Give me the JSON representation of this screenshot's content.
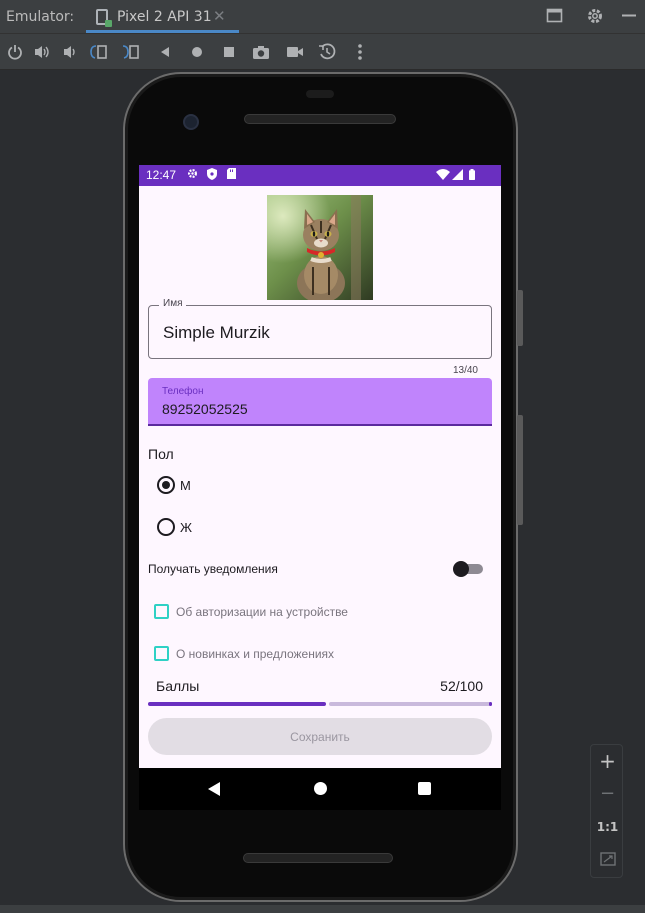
{
  "ide": {
    "title": "Emulator:",
    "tab_label": "Pixel 2 API 31",
    "tab_close": "✕"
  },
  "icons": {
    "maximize": "maximize-icon",
    "settings": "gear-icon",
    "minimize": "minimize-icon",
    "toolbar": [
      "power-icon",
      "volume-up-icon",
      "volume-down-icon",
      "rotate-left-icon",
      "rotate-right-icon",
      "back-icon",
      "home-icon",
      "overview-icon",
      "screenshot-icon",
      "record-icon",
      "snapshot-icon",
      "more-icon"
    ]
  },
  "status_bar": {
    "time": "12:47",
    "color": "#6a2fc0"
  },
  "form": {
    "name_label": "Имя",
    "name_value": "Simple Murzik",
    "name_counter": "13/40",
    "phone_label": "Телефон",
    "phone_value": "89252052525",
    "gender_label": "Пол",
    "gender_options": [
      {
        "label": "М",
        "checked": true
      },
      {
        "label": "Ж",
        "checked": false
      }
    ],
    "notifications_label": "Получать уведомления",
    "notifications_on": false,
    "checkboxes": [
      {
        "label": "Об авторизации на устройстве",
        "checked": false
      },
      {
        "label": "О новинках и предложениях",
        "checked": false
      }
    ],
    "score_label": "Баллы",
    "score_value": "52/100",
    "score_fraction": 0.52,
    "save_label": "Сохранить"
  },
  "zoom": {
    "plus": "+",
    "minus": "−",
    "one_to_one": "1:1"
  },
  "colors": {
    "accent": "#6a2fc0",
    "phone_field_bg": "#c084fc",
    "checkbox": "#2fd1c5"
  }
}
